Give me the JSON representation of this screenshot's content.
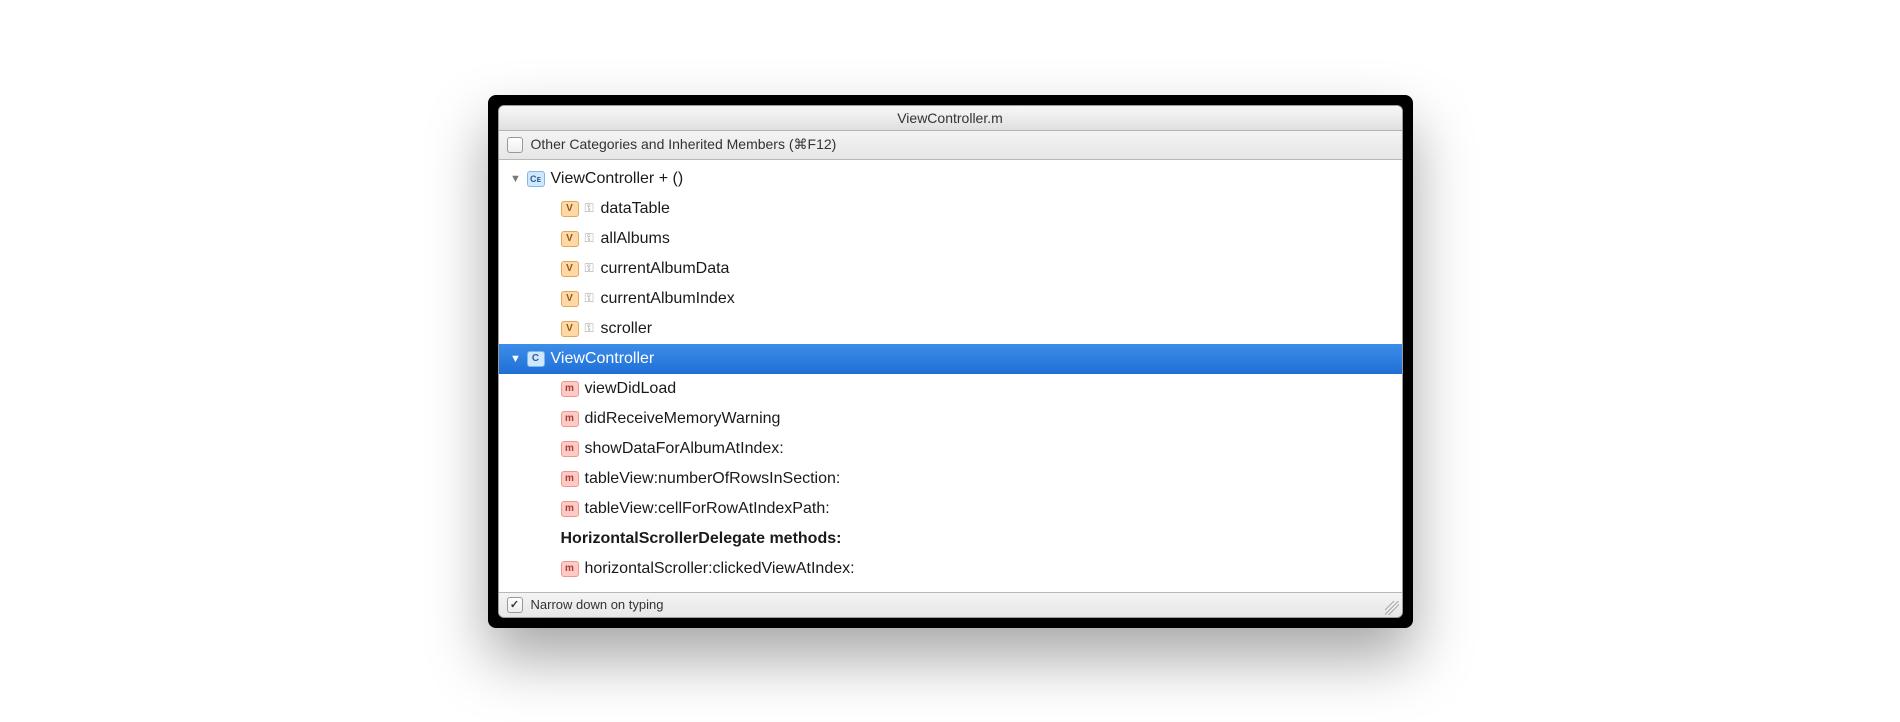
{
  "window": {
    "title": "ViewController.m"
  },
  "toolbar": {
    "other_categories_label": "Other Categories and Inherited Members (⌘F12)",
    "other_categories_checked": false
  },
  "tree": {
    "groups": [
      {
        "label": "ViewController + ()",
        "icon": "CE",
        "expanded": true,
        "selected": false,
        "children": [
          {
            "label": "dataTable",
            "icon": "V",
            "keyIcon": true
          },
          {
            "label": "allAlbums",
            "icon": "V",
            "keyIcon": true
          },
          {
            "label": "currentAlbumData",
            "icon": "V",
            "keyIcon": true
          },
          {
            "label": "currentAlbumIndex",
            "icon": "V",
            "keyIcon": true
          },
          {
            "label": "scroller",
            "icon": "V",
            "keyIcon": true
          }
        ]
      },
      {
        "label": "ViewController",
        "icon": "C",
        "expanded": true,
        "selected": true,
        "children": [
          {
            "label": "viewDidLoad",
            "icon": "m"
          },
          {
            "label": "didReceiveMemoryWarning",
            "icon": "m"
          },
          {
            "label": "showDataForAlbumAtIndex:",
            "icon": "m"
          },
          {
            "label": "tableView:numberOfRowsInSection:",
            "icon": "m"
          },
          {
            "label": "tableView:cellForRowAtIndexPath:",
            "icon": "m"
          },
          {
            "label": "HorizontalScrollerDelegate methods:",
            "icon": "",
            "bold": true
          },
          {
            "label": "horizontalScroller:clickedViewAtIndex:",
            "icon": "m"
          }
        ]
      }
    ]
  },
  "footer": {
    "narrow_label": "Narrow down on typing",
    "narrow_checked": true
  }
}
